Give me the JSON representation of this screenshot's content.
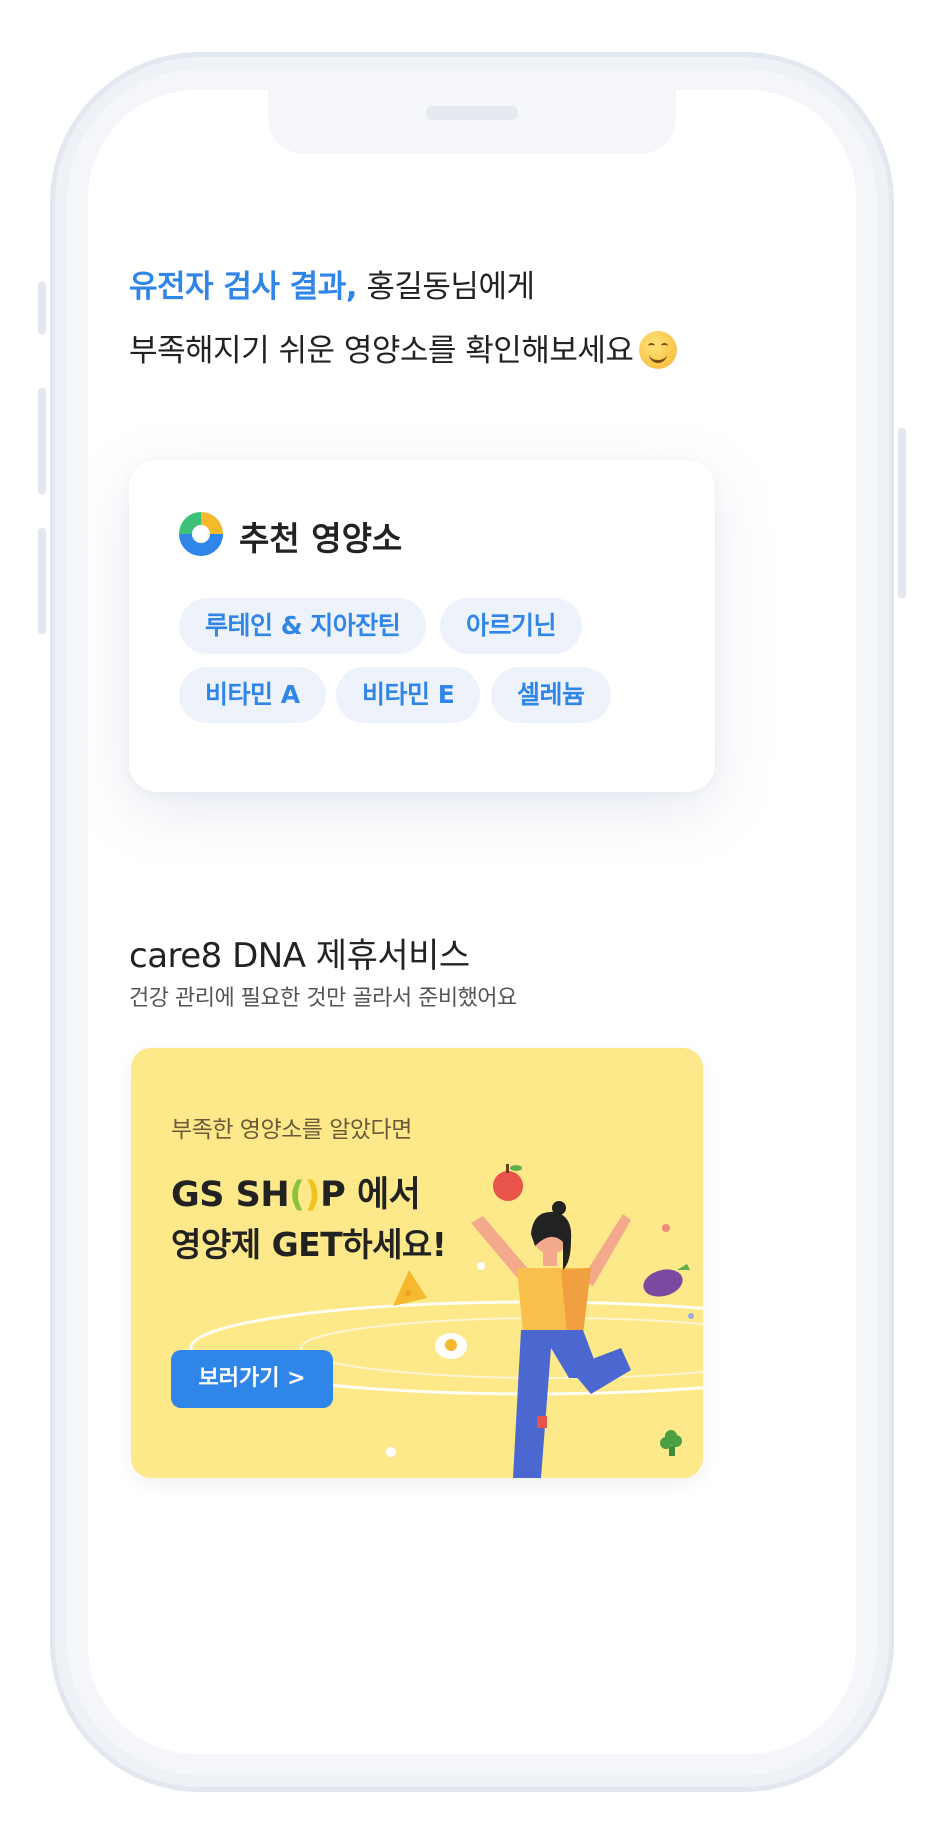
{
  "greeting": {
    "accent": "유전자 검사 결과,",
    "line1_rest": " 홍길동님에게",
    "line2": "부족해지기 쉬운 영양소를 확인해보세요"
  },
  "recommend_card": {
    "title": "추천 영양소",
    "chips": [
      "루테인 & 지아잔틴",
      "아르기닌",
      "비타민 A",
      "비타민 E",
      "셀레늄"
    ]
  },
  "partner_section": {
    "title": "care8 DNA 제휴서비스",
    "subtitle": "건강 관리에 필요한 것만 골라서 준비했어요"
  },
  "banner": {
    "subtitle": "부족한 영양소를 알았다면",
    "headline_pre": "GS SH",
    "headline_o_left": "(",
    "headline_o_right": ")",
    "headline_post": "P",
    "headline_suffix": " 에서",
    "headline_line2": "영양제 GET하세요!",
    "button_label": "보러가기 >"
  },
  "colors": {
    "accent": "#2f86e8",
    "banner_bg": "#fde98a",
    "chip_bg": "#eef3fb"
  }
}
